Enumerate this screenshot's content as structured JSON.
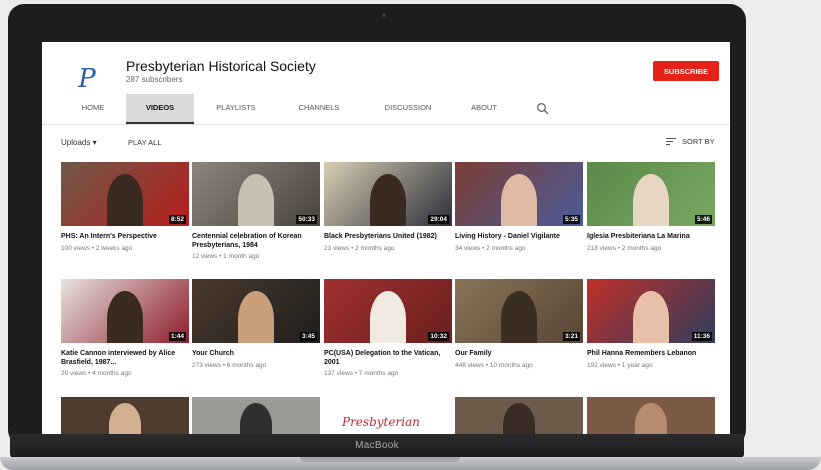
{
  "channel": {
    "logo_letter": "P",
    "name": "Presbyterian Historical Society",
    "subscribers": "287 subscribers",
    "subscribe_label": "SUBSCRIBE"
  },
  "tabs": [
    {
      "label": "HOME"
    },
    {
      "label": "VIDEOS",
      "active": true
    },
    {
      "label": "PLAYLISTS"
    },
    {
      "label": "CHANNELS"
    },
    {
      "label": "DISCUSSION"
    },
    {
      "label": "ABOUT"
    }
  ],
  "toolbar": {
    "uploads_label": "Uploads",
    "play_all_label": "PLAY ALL",
    "sort_label": "SORT BY"
  },
  "videos": [
    {
      "title": "PHS: An Intern's Perspective",
      "meta": "100 views • 2 weeks ago",
      "duration": "8:52",
      "bg": "#6e5a4b",
      "fig": "#3b2a22",
      "accent": "#b71c1c"
    },
    {
      "title": "Centennial celebration of Korean Presbyterians, 1984",
      "meta": "12 views • 1 month ago",
      "duration": "50:33",
      "bg": "#8d857a",
      "fig": "#c9c0b4",
      "accent": "#4a443e"
    },
    {
      "title": "Black Presbyterians United (1982)",
      "meta": "23 views • 2 months ago",
      "duration": "29:04",
      "bg": "#d9cdb3",
      "fig": "#3a2a22",
      "accent": "#2b2f3a"
    },
    {
      "title": "Living History - Daniel Vigilante",
      "meta": "34 views • 2 months ago",
      "duration": "5:35",
      "bg": "#7b3e33",
      "fig": "#e0b9a4",
      "accent": "#4b5b9a"
    },
    {
      "title": "Iglesia Presbiteriana La Marina",
      "meta": "218 views • 2 months ago",
      "duration": "5:46",
      "bg": "#5a8a4a",
      "fig": "#e6d6c2",
      "accent": "#7aa863"
    },
    {
      "title": "Katie Cannon interviewed by Alice Brasfield, 1987...",
      "meta": "20 views • 4 months ago",
      "duration": "1:44",
      "bg": "#e7e3de",
      "fig": "#3b2a20",
      "accent": "#8e1c2b"
    },
    {
      "title": "Your Church",
      "meta": "273 views • 6 months ago",
      "duration": "3:45",
      "bg": "#4b3a2c",
      "fig": "#c89f7a",
      "accent": "#1e1e1e"
    },
    {
      "title": "PC(USA) Delegation to the Vatican, 2001",
      "meta": "137 views • 7 months ago",
      "duration": "10:32",
      "bg": "#a0302f",
      "fig": "#efe9df",
      "accent": "#6a1f1f"
    },
    {
      "title": "Our Family",
      "meta": "448 views • 10 months ago",
      "duration": "3:21",
      "bg": "#8a7458",
      "fig": "#3a2d22",
      "accent": "#574634"
    },
    {
      "title": "Phil Hanna Remembers Lebanon",
      "meta": "192 views • 1 year ago",
      "duration": "11:36",
      "bg": "#c0302a",
      "fig": "#e8c0a8",
      "accent": "#2e3d5e"
    }
  ],
  "partial_thumbs": [
    {
      "bg": "#4e3d2f",
      "fig": "#d3b08f",
      "text": ""
    },
    {
      "bg": "#9a9a96",
      "fig": "#2f2f2f",
      "text": ""
    },
    {
      "bg": "#ffffff",
      "fig": "#c7262d",
      "text": "Presbyterian"
    },
    {
      "bg": "#6d5a48",
      "fig": "#3a2c24",
      "text": ""
    },
    {
      "bg": "#7d5a46",
      "fig": "#b88c6e",
      "text": ""
    }
  ],
  "device": {
    "brand": "MacBook"
  }
}
